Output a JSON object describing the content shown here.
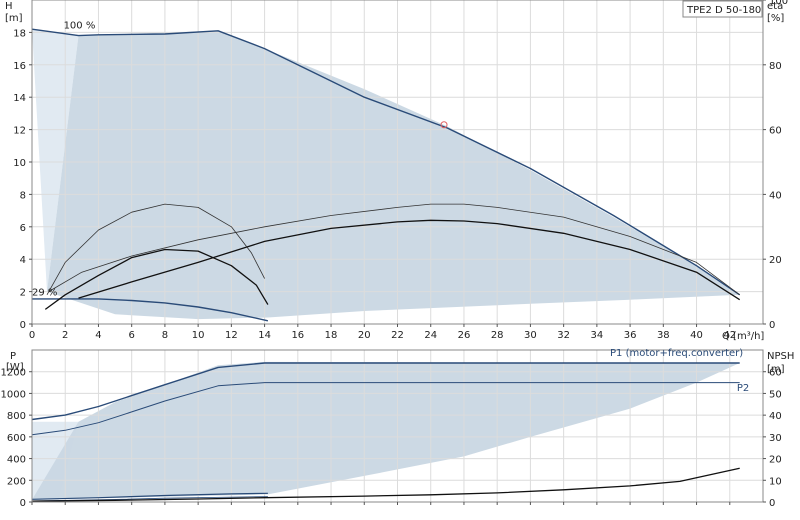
{
  "chart_data": [
    {
      "type": "line",
      "title_box": "TPE2 D 50-180",
      "xlabel": "Q [m³/h]",
      "ylabel_left": "H\n[m]",
      "ylabel_right": "eta\n[%]",
      "xlim": [
        0,
        44
      ],
      "ylim_left": [
        0,
        20
      ],
      "ylim_right": [
        0,
        100
      ],
      "x_ticks": [
        0,
        2,
        4,
        6,
        8,
        10,
        12,
        14,
        16,
        18,
        20,
        22,
        24,
        26,
        28,
        30,
        32,
        34,
        36,
        38,
        40,
        42
      ],
      "y_ticks_left": [
        0,
        2,
        4,
        6,
        8,
        10,
        12,
        14,
        16,
        18
      ],
      "y_ticks_right": [
        0,
        20,
        40,
        60,
        80,
        100
      ],
      "grid": true,
      "annotations": [
        {
          "text": "100 %",
          "x": 1.9,
          "y": 18.5
        },
        {
          "text": "29 %",
          "x": 0.0,
          "y": 2.0
        }
      ],
      "duty_point": {
        "x": 24.8,
        "y": 12.3,
        "color": "#e06060"
      },
      "operating_area": {
        "color": "#c9d7e3",
        "outline": [
          [
            0.9,
            2.0
          ],
          [
            2.8,
            17.8
          ],
          [
            11.2,
            18.1
          ],
          [
            14.0,
            17.0
          ],
          [
            20.0,
            14.5
          ],
          [
            25.0,
            12.2
          ],
          [
            30.0,
            9.5
          ],
          [
            35.0,
            6.6
          ],
          [
            40.0,
            3.6
          ],
          [
            42.6,
            1.8
          ],
          [
            36.0,
            1.5
          ],
          [
            30.0,
            1.25
          ],
          [
            20.0,
            0.8
          ],
          [
            14.2,
            0.4
          ],
          [
            10.0,
            0.3
          ],
          [
            5.0,
            0.6
          ],
          [
            0.9,
            2.0
          ]
        ]
      },
      "light_band": {
        "color": "#e1eaf2",
        "outline": [
          [
            0.0,
            18.2
          ],
          [
            2.8,
            17.8
          ],
          [
            0.9,
            2.0
          ],
          [
            0.0,
            18.2
          ]
        ]
      },
      "series": [
        {
          "role": "curve-100pct",
          "axis": "left",
          "color": "#2a4b78",
          "width": 1.4,
          "points": [
            [
              0.0,
              18.2
            ],
            [
              2.8,
              17.8
            ],
            [
              4.0,
              17.85
            ],
            [
              8.0,
              17.9
            ],
            [
              11.2,
              18.1
            ],
            [
              14.0,
              17.0
            ],
            [
              17.0,
              15.5
            ],
            [
              20.0,
              14.0
            ],
            [
              25.0,
              12.1
            ],
            [
              30.0,
              9.6
            ],
            [
              35.0,
              6.7
            ],
            [
              40.0,
              3.6
            ],
            [
              42.6,
              1.8
            ]
          ]
        },
        {
          "role": "curve-29pct",
          "axis": "left",
          "color": "#2a4b78",
          "width": 1.4,
          "points": [
            [
              0.0,
              1.55
            ],
            [
              2.0,
              1.55
            ],
            [
              4.0,
              1.55
            ],
            [
              6.0,
              1.45
            ],
            [
              8.0,
              1.3
            ],
            [
              10.0,
              1.05
            ],
            [
              12.0,
              0.7
            ],
            [
              14.2,
              0.2
            ]
          ]
        },
        {
          "role": "eta-100pct",
          "axis": "right",
          "color": "#333333",
          "width": 0.8,
          "points": [
            [
              1.0,
              10
            ],
            [
              3.0,
              16
            ],
            [
              6.0,
              21
            ],
            [
              10.0,
              26
            ],
            [
              14.0,
              30
            ],
            [
              18.0,
              33.5
            ],
            [
              22.0,
              36
            ],
            [
              24.0,
              37
            ],
            [
              26.0,
              37
            ],
            [
              28.0,
              36
            ],
            [
              32.0,
              33
            ],
            [
              36.0,
              27
            ],
            [
              40.0,
              19
            ],
            [
              42.6,
              9
            ]
          ]
        },
        {
          "role": "p2-100pct",
          "axis": "right",
          "color": "#111111",
          "width": 1.3,
          "points": [
            [
              2.8,
              8
            ],
            [
              6.0,
              13
            ],
            [
              10.0,
              19
            ],
            [
              14.0,
              25.5
            ],
            [
              18.0,
              29.5
            ],
            [
              22.0,
              31.5
            ],
            [
              24.0,
              32
            ],
            [
              26.0,
              31.8
            ],
            [
              28.0,
              31
            ],
            [
              32.0,
              28
            ],
            [
              36.0,
              23
            ],
            [
              40.0,
              16
            ],
            [
              42.6,
              7.5
            ]
          ]
        },
        {
          "role": "eta-29pct",
          "axis": "right",
          "color": "#333333",
          "width": 0.8,
          "points": [
            [
              0.9,
              9
            ],
            [
              2.0,
              19
            ],
            [
              4.0,
              29
            ],
            [
              6.0,
              34.5
            ],
            [
              8.0,
              37
            ],
            [
              10.0,
              36
            ],
            [
              12.0,
              30
            ],
            [
              13.2,
              22
            ],
            [
              14.0,
              14
            ]
          ]
        },
        {
          "role": "p2-29pct",
          "axis": "right",
          "color": "#111111",
          "width": 1.3,
          "points": [
            [
              0.8,
              4.5
            ],
            [
              2.0,
              9
            ],
            [
              4.0,
              15
            ],
            [
              6.0,
              20.5
            ],
            [
              8.0,
              23
            ],
            [
              10.0,
              22.5
            ],
            [
              12.0,
              18
            ],
            [
              13.5,
              12
            ],
            [
              14.2,
              6
            ]
          ]
        }
      ]
    },
    {
      "type": "line",
      "ylabel_left": "P\n[W]",
      "ylabel_right": "NPSH\n[m]",
      "xlim": [
        0,
        44
      ],
      "ylim_left": [
        0,
        1400
      ],
      "ylim_right": [
        0,
        70
      ],
      "y_ticks_left": [
        0,
        200,
        400,
        600,
        800,
        1000,
        1200
      ],
      "y_ticks_right": [
        0,
        10,
        20,
        30,
        40,
        50,
        60
      ],
      "grid": true,
      "series_labels": [
        {
          "text": "P1 (motor+freq.converter)",
          "x": 38.8,
          "y": 1380
        },
        {
          "text": "P2",
          "x": 42.8,
          "y": 1060
        }
      ],
      "operating_area": {
        "color": "#c9d7e3",
        "outline": [
          [
            2.8,
            740
          ],
          [
            5.0,
            920
          ],
          [
            8.0,
            1080
          ],
          [
            11.2,
            1260
          ],
          [
            14.0,
            1290
          ],
          [
            42.6,
            1280
          ],
          [
            40.0,
            1100
          ],
          [
            36.0,
            860
          ],
          [
            30.0,
            600
          ],
          [
            26.0,
            420
          ],
          [
            20.0,
            240
          ],
          [
            14.2,
            70
          ],
          [
            0.0,
            20
          ],
          [
            2.8,
            740
          ]
        ]
      },
      "light_band": {
        "color": "#e1eaf2",
        "outline": [
          [
            0.0,
            740
          ],
          [
            2.8,
            740
          ],
          [
            1.6,
            20
          ],
          [
            0.0,
            20
          ],
          [
            0.0,
            740
          ]
        ]
      },
      "series": [
        {
          "role": "p1-100pct",
          "axis": "left",
          "color": "#2a4b78",
          "width": 1.4,
          "points": [
            [
              0.0,
              760
            ],
            [
              2.0,
              800
            ],
            [
              4.0,
              880
            ],
            [
              6.0,
              980
            ],
            [
              8.0,
              1080
            ],
            [
              11.2,
              1240
            ],
            [
              14.0,
              1280
            ],
            [
              20.0,
              1280
            ],
            [
              30.0,
              1280
            ],
            [
              42.6,
              1280
            ]
          ]
        },
        {
          "role": "p2-100pct",
          "axis": "left",
          "color": "#2a4b78",
          "width": 1.0,
          "points": [
            [
              0.0,
              620
            ],
            [
              2.0,
              660
            ],
            [
              4.0,
              730
            ],
            [
              6.0,
              830
            ],
            [
              8.0,
              930
            ],
            [
              11.2,
              1070
            ],
            [
              14.0,
              1100
            ],
            [
              20.0,
              1100
            ],
            [
              30.0,
              1100
            ],
            [
              42.6,
              1100
            ]
          ]
        },
        {
          "role": "p1-29pct",
          "axis": "left",
          "color": "#2a4b78",
          "width": 1.2,
          "points": [
            [
              0.0,
              25
            ],
            [
              4.0,
              40
            ],
            [
              8.0,
              60
            ],
            [
              12.0,
              75
            ],
            [
              14.2,
              80
            ]
          ]
        },
        {
          "role": "p2-29pct",
          "axis": "left",
          "color": "#2a4b78",
          "width": 0.8,
          "points": [
            [
              0.0,
              10
            ],
            [
              4.0,
              20
            ],
            [
              8.0,
              35
            ],
            [
              12.0,
              45
            ],
            [
              14.2,
              50
            ]
          ]
        },
        {
          "role": "npsh",
          "axis": "right",
          "color": "#111111",
          "width": 1.3,
          "points": [
            [
              0.0,
              0.4
            ],
            [
              5.0,
              0.8
            ],
            [
              10.0,
              1.4
            ],
            [
              14.0,
              2.0
            ],
            [
              20.0,
              2.7
            ],
            [
              24.0,
              3.3
            ],
            [
              28.0,
              4.2
            ],
            [
              32.0,
              5.6
            ],
            [
              36.0,
              7.4
            ],
            [
              39.0,
              9.5
            ],
            [
              42.6,
              15.5
            ]
          ]
        }
      ]
    }
  ]
}
